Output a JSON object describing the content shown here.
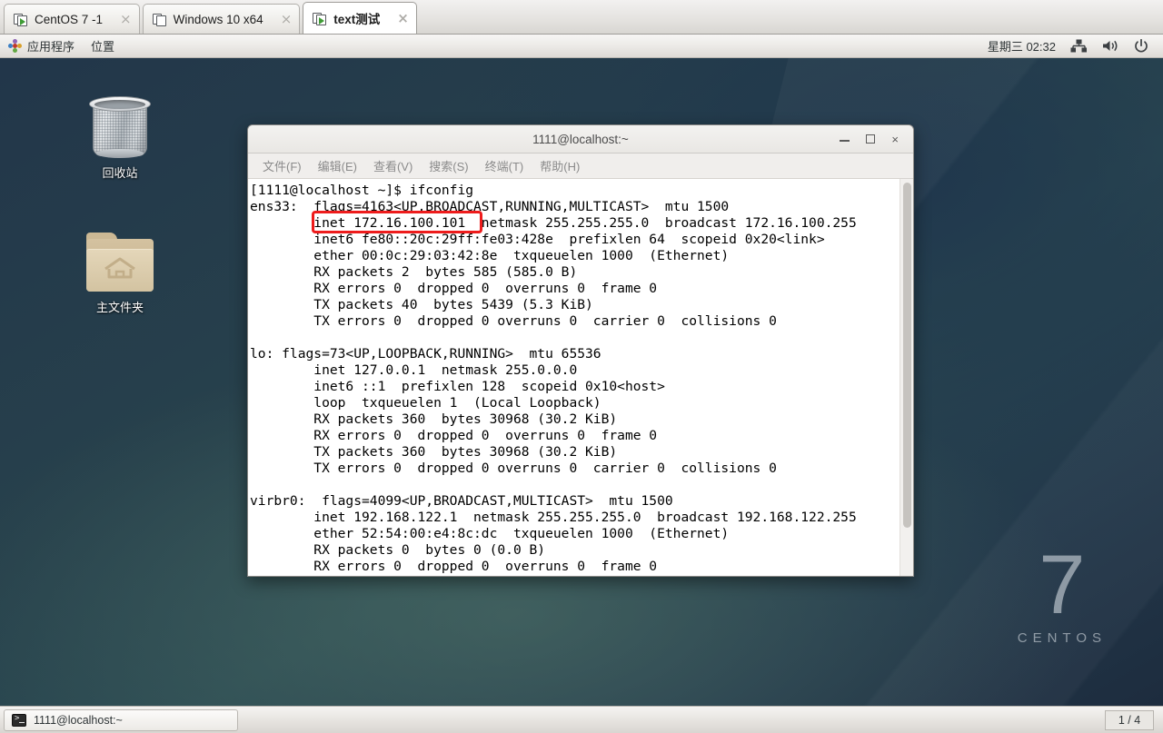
{
  "vmware_tabs": [
    {
      "label": "CentOS 7 -1",
      "icon": "vm-powered-icon",
      "close": "×",
      "active": false
    },
    {
      "label": "Windows 10 x64",
      "icon": "vm-stopped-icon",
      "close": "×",
      "active": false
    },
    {
      "label": "text测试",
      "icon": "vm-powered-icon",
      "close": "×",
      "active": true
    }
  ],
  "top_panel": {
    "applications": "应用程序",
    "places": "位置",
    "clock": "星期三 02:32",
    "icons": [
      "network-icon",
      "volume-icon",
      "power-icon"
    ]
  },
  "desktop": {
    "icons": [
      {
        "name": "trash-icon",
        "label": "回收站"
      },
      {
        "name": "home-folder-icon",
        "label": "主文件夹"
      }
    ],
    "watermark": {
      "number": "7",
      "word": "CENTOS"
    },
    "background_color": "#27414c"
  },
  "terminal": {
    "title": "1111@localhost:~",
    "window_buttons": {
      "minimize": "minimize-icon",
      "maximize": "maximize-icon",
      "close": "×"
    },
    "menu": [
      "文件(F)",
      "编辑(E)",
      "查看(V)",
      "搜索(S)",
      "终端(T)",
      "帮助(H)"
    ],
    "content": "[1111@localhost ~]$ ifconfig\nens33:  flags=4163<UP,BROADCAST,RUNNING,MULTICAST>  mtu 1500\n        inet 172.16.100.101  netmask 255.255.255.0  broadcast 172.16.100.255\n        inet6 fe80::20c:29ff:fe03:428e  prefixlen 64  scopeid 0x20<link>\n        ether 00:0c:29:03:42:8e  txqueuelen 1000  (Ethernet)\n        RX packets 2  bytes 585 (585.0 B)\n        RX errors 0  dropped 0  overruns 0  frame 0\n        TX packets 40  bytes 5439 (5.3 KiB)\n        TX errors 0  dropped 0 overruns 0  carrier 0  collisions 0\n\nlo: flags=73<UP,LOOPBACK,RUNNING>  mtu 65536\n        inet 127.0.0.1  netmask 255.0.0.0\n        inet6 ::1  prefixlen 128  scopeid 0x10<host>\n        loop  txqueuelen 1  (Local Loopback)\n        RX packets 360  bytes 30968 (30.2 KiB)\n        RX errors 0  dropped 0  overruns 0  frame 0\n        TX packets 360  bytes 30968 (30.2 KiB)\n        TX errors 0  dropped 0 overruns 0  carrier 0  collisions 0\n\nvirbr0:  flags=4099<UP,BROADCAST,MULTICAST>  mtu 1500\n        inet 192.168.122.1  netmask 255.255.255.0  broadcast 192.168.122.255\n        ether 52:54:00:e4:8c:dc  txqueuelen 1000  (Ethernet)\n        RX packets 0  bytes 0 (0.0 B)\n        RX errors 0  dropped 0  overruns 0  frame 0",
    "annotation": {
      "name": "inet-address-highlight",
      "text": "inet 172.16.100.101",
      "color": "#ee1c1c"
    }
  },
  "taskbar": {
    "window_button": "1111@localhost:~",
    "workspace_indicator": "1 / 4"
  }
}
